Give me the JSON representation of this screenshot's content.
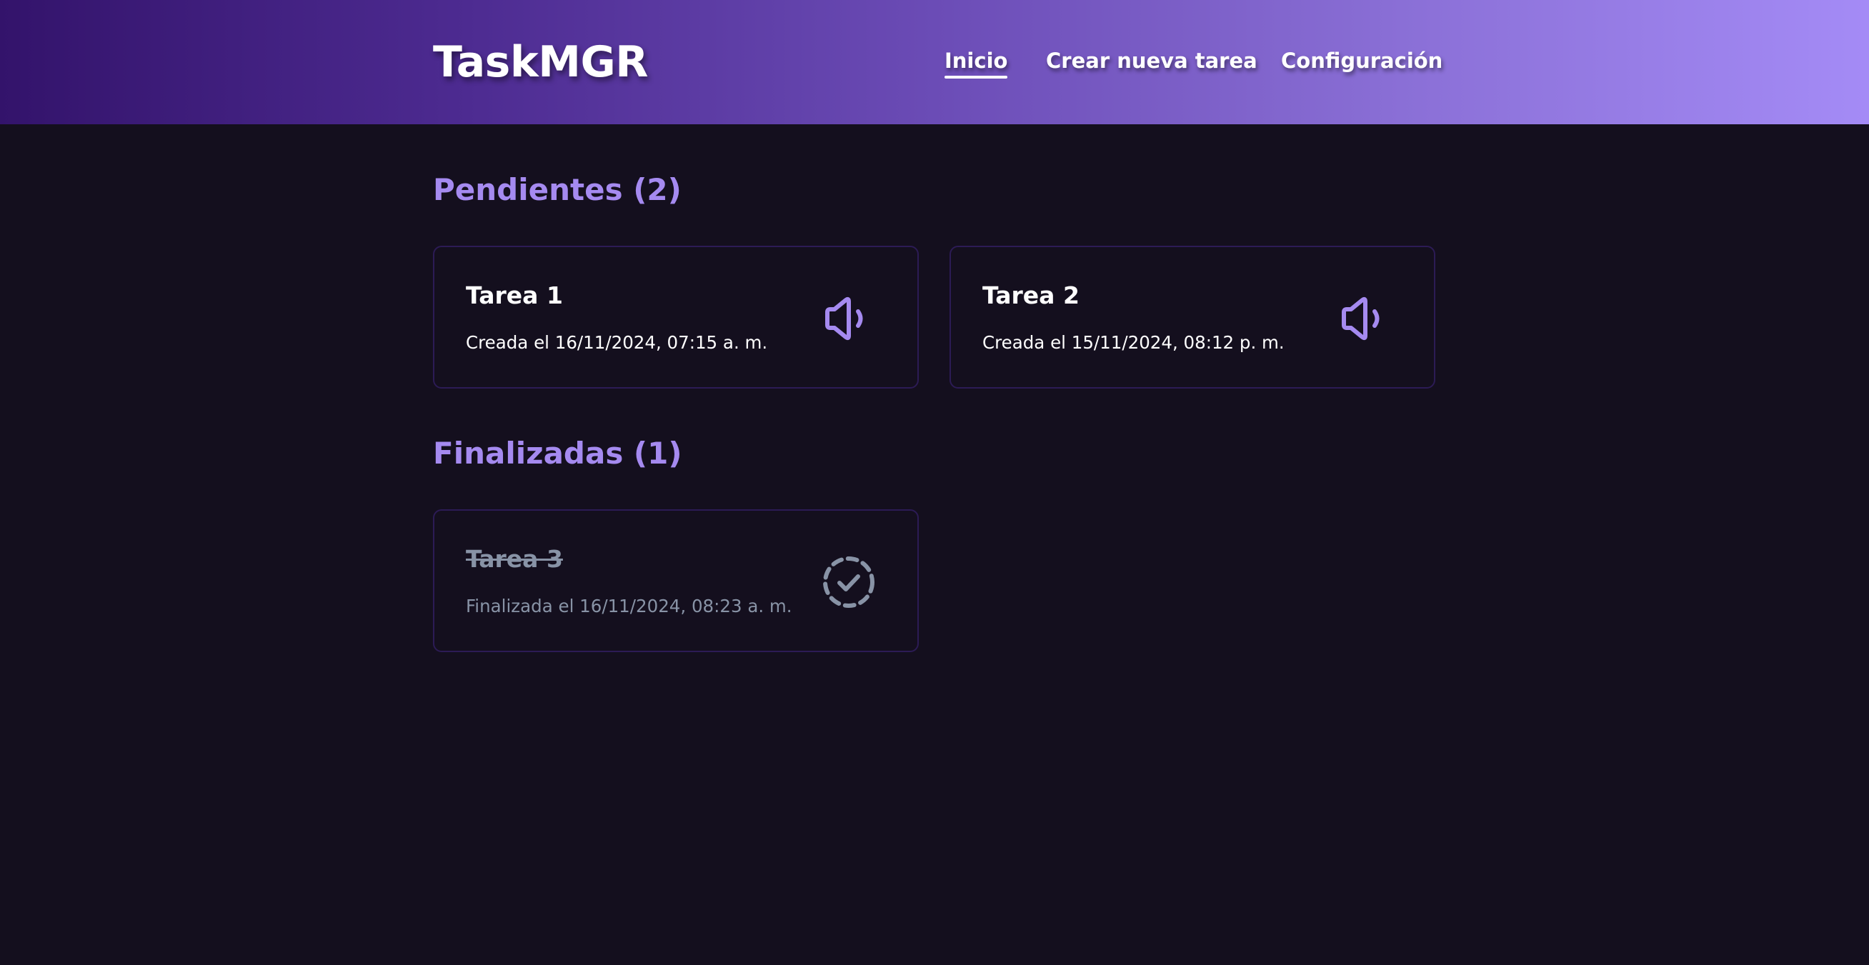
{
  "header": {
    "logo": "TaskMGR",
    "nav": [
      {
        "label": "Inicio",
        "active": true
      },
      {
        "label": "Crear nueva tarea",
        "active": false
      },
      {
        "label": "Configuración",
        "active": false
      }
    ]
  },
  "pending": {
    "title": "Pendientes (2)",
    "tasks": [
      {
        "title": "Tarea 1",
        "subtitle": "Creada el 16/11/2024, 07:15 a. m.",
        "icon": "speaker-icon"
      },
      {
        "title": "Tarea 2",
        "subtitle": "Creada el 15/11/2024, 08:12 p. m.",
        "icon": "speaker-icon"
      }
    ]
  },
  "done": {
    "title": "Finalizadas (1)",
    "tasks": [
      {
        "title": "Tarea 3",
        "subtitle": "Finalizada el 16/11/2024, 08:23 a. m.",
        "icon": "dashed-check-circle-icon"
      }
    ]
  },
  "colors": {
    "accent": "#a58af0",
    "background": "#140f1e",
    "card_border": "#2c1b55",
    "muted": "#8893a6"
  }
}
